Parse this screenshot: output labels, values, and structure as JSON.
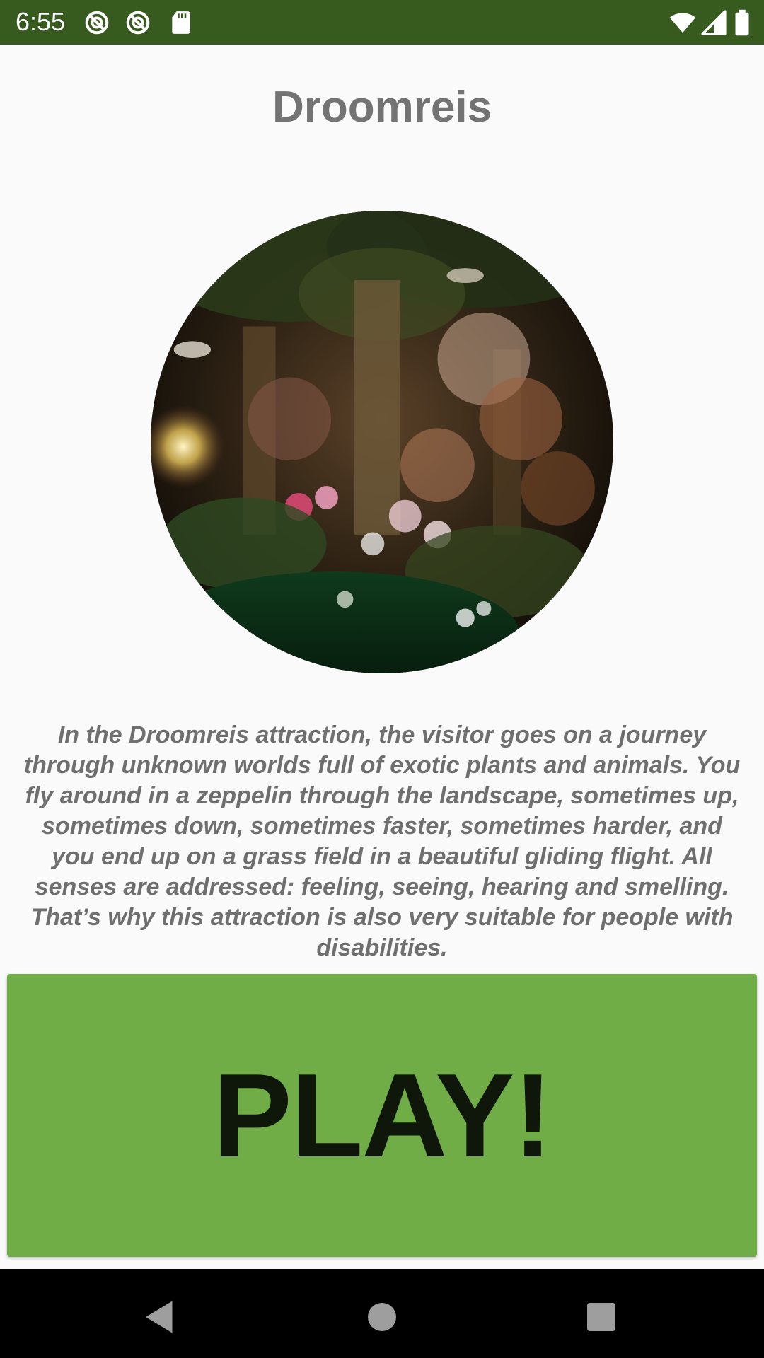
{
  "status_bar": {
    "time": "6:55",
    "background_color": "#375a1e",
    "left_icons": [
      "no-location-icon",
      "no-location-icon",
      "sd-card-icon"
    ],
    "right_icons": [
      "wifi-icon",
      "cellular-signal-icon",
      "battery-icon"
    ]
  },
  "app": {
    "title": "Droomreis",
    "image_name": "droomreis-attraction-photo",
    "description": "In the Droomreis attraction, the visitor goes on a journey through unknown worlds full of exotic plants and animals. You fly around in a zeppelin through the landscape, sometimes up, sometimes down, sometimes faster, sometimes harder, and you end up on a grass field in a beautiful gliding flight. All senses are addressed: feeling, seeing, hearing and smelling. That’s why this attraction is also very suitable for people with disabilities.",
    "play_label": "PLAY!",
    "play_color": "#70ad47"
  },
  "nav_bar": {
    "icons": [
      "back-triangle-icon",
      "home-circle-icon",
      "recents-square-icon"
    ]
  }
}
